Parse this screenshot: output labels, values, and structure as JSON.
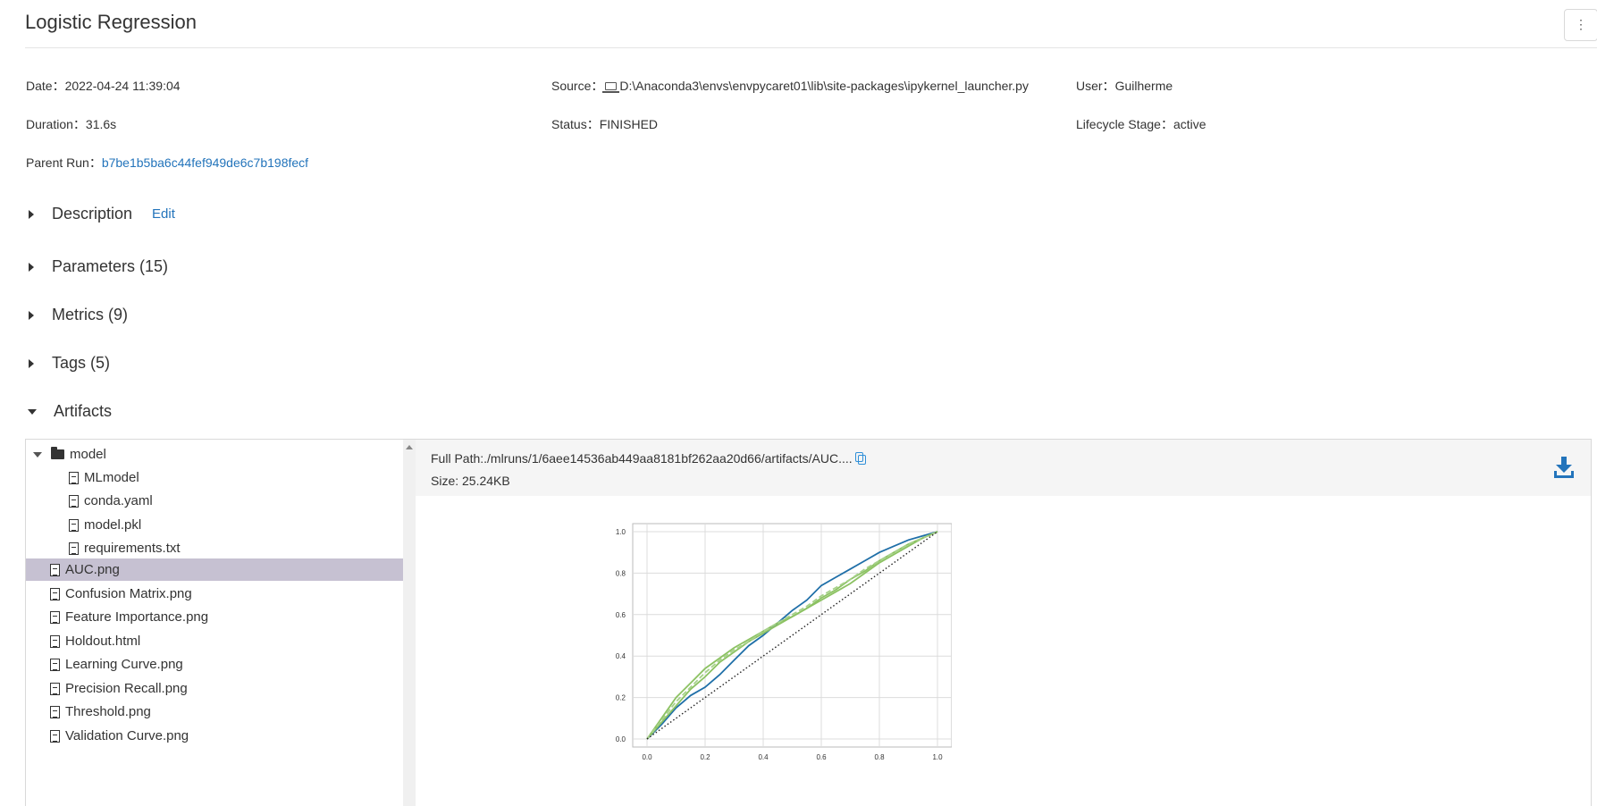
{
  "page": {
    "title": "Logistic Regression",
    "menu_label": "⋮"
  },
  "meta": {
    "date_label": "Date：",
    "date_value": "2022-04-24 11:39:04",
    "source_label": "Source：",
    "source_value": "D:\\Anaconda3\\envs\\envpycaret01\\lib\\site-packages\\ipykernel_launcher.py",
    "user_label": "User：",
    "user_value": "Guilherme",
    "duration_label": "Duration：",
    "duration_value": "31.6s",
    "status_label": "Status：",
    "status_value": "FINISHED",
    "lifecycle_label": "Lifecycle Stage：",
    "lifecycle_value": "active",
    "parent_label": "Parent Run：",
    "parent_value": "b7be1b5ba6c44fef949de6c7b198fecf"
  },
  "sections": {
    "description": "Description",
    "edit": "Edit",
    "parameters": "Parameters (15)",
    "metrics": "Metrics (9)",
    "tags": "Tags (5)",
    "artifacts": "Artifacts"
  },
  "tree": {
    "folder": "model",
    "children": [
      "MLmodel",
      "conda.yaml",
      "model.pkl",
      "requirements.txt"
    ],
    "files": [
      "AUC.png",
      "Confusion Matrix.png",
      "Feature Importance.png",
      "Holdout.html",
      "Learning Curve.png",
      "Precision Recall.png",
      "Threshold.png",
      "Validation Curve.png"
    ],
    "selected": "AUC.png"
  },
  "preview": {
    "full_path": "Full Path:./mlruns/1/6aee14536ab449aa8181bf262aa20d66/artifacts/AUC....",
    "size": "Size: 25.24KB"
  },
  "colors": {
    "link": "#2374bb",
    "selected": "#c6c1d2",
    "curve_blue": "#1f6fa8",
    "curve_green": "#8cc262"
  },
  "chart_data": {
    "type": "line",
    "xlim": [
      0,
      1
    ],
    "ylim": [
      0,
      1
    ],
    "x_ticks": [
      "0.0",
      "0.2",
      "0.4",
      "0.6",
      "0.8",
      "1.0"
    ],
    "y_ticks": [
      "0.0",
      "0.2",
      "0.4",
      "0.6",
      "0.8",
      "1.0"
    ],
    "grid": true,
    "series": [
      {
        "color": "#1f6fa8",
        "style": "solid",
        "x": [
          0,
          0.05,
          0.1,
          0.15,
          0.2,
          0.25,
          0.3,
          0.35,
          0.4,
          0.45,
          0.5,
          0.55,
          0.6,
          0.65,
          0.7,
          0.75,
          0.8,
          0.85,
          0.9,
          0.95,
          1
        ],
        "y": [
          0,
          0.07,
          0.15,
          0.21,
          0.25,
          0.31,
          0.38,
          0.45,
          0.5,
          0.56,
          0.62,
          0.67,
          0.74,
          0.78,
          0.82,
          0.86,
          0.9,
          0.93,
          0.96,
          0.98,
          1
        ]
      },
      {
        "color": "#8cc262",
        "style": "solid",
        "x": [
          0,
          0.05,
          0.1,
          0.15,
          0.2,
          0.25,
          0.3,
          0.35,
          0.4,
          0.45,
          0.5,
          0.55,
          0.6,
          0.65,
          0.7,
          0.75,
          0.8,
          0.85,
          0.9,
          0.95,
          1
        ],
        "y": [
          0,
          0.1,
          0.2,
          0.27,
          0.34,
          0.39,
          0.44,
          0.48,
          0.52,
          0.56,
          0.59,
          0.63,
          0.67,
          0.71,
          0.75,
          0.8,
          0.85,
          0.89,
          0.93,
          0.97,
          1
        ]
      },
      {
        "color": "#8cc262",
        "style": "solid",
        "x": [
          0,
          0.05,
          0.1,
          0.15,
          0.2,
          0.25,
          0.3,
          0.35,
          0.4,
          0.45,
          0.5,
          0.55,
          0.6,
          0.65,
          0.7,
          0.75,
          0.8,
          0.85,
          0.9,
          0.95,
          1
        ],
        "y": [
          0,
          0.08,
          0.16,
          0.24,
          0.3,
          0.37,
          0.42,
          0.47,
          0.51,
          0.55,
          0.59,
          0.63,
          0.68,
          0.72,
          0.77,
          0.81,
          0.86,
          0.9,
          0.94,
          0.97,
          1
        ]
      },
      {
        "color": "#a6d18a",
        "style": "dashed",
        "x": [
          0,
          0.05,
          0.1,
          0.15,
          0.2,
          0.25,
          0.3,
          0.35,
          0.4,
          0.45,
          0.5,
          0.55,
          0.6,
          0.65,
          0.7,
          0.75,
          0.8,
          0.85,
          0.9,
          0.95,
          1
        ],
        "y": [
          0,
          0.09,
          0.18,
          0.25,
          0.32,
          0.38,
          0.43,
          0.47,
          0.52,
          0.56,
          0.6,
          0.64,
          0.69,
          0.73,
          0.77,
          0.82,
          0.86,
          0.9,
          0.94,
          0.97,
          1
        ]
      },
      {
        "color": "#222222",
        "style": "dotted",
        "x": [
          0,
          1
        ],
        "y": [
          0,
          1
        ]
      }
    ]
  }
}
